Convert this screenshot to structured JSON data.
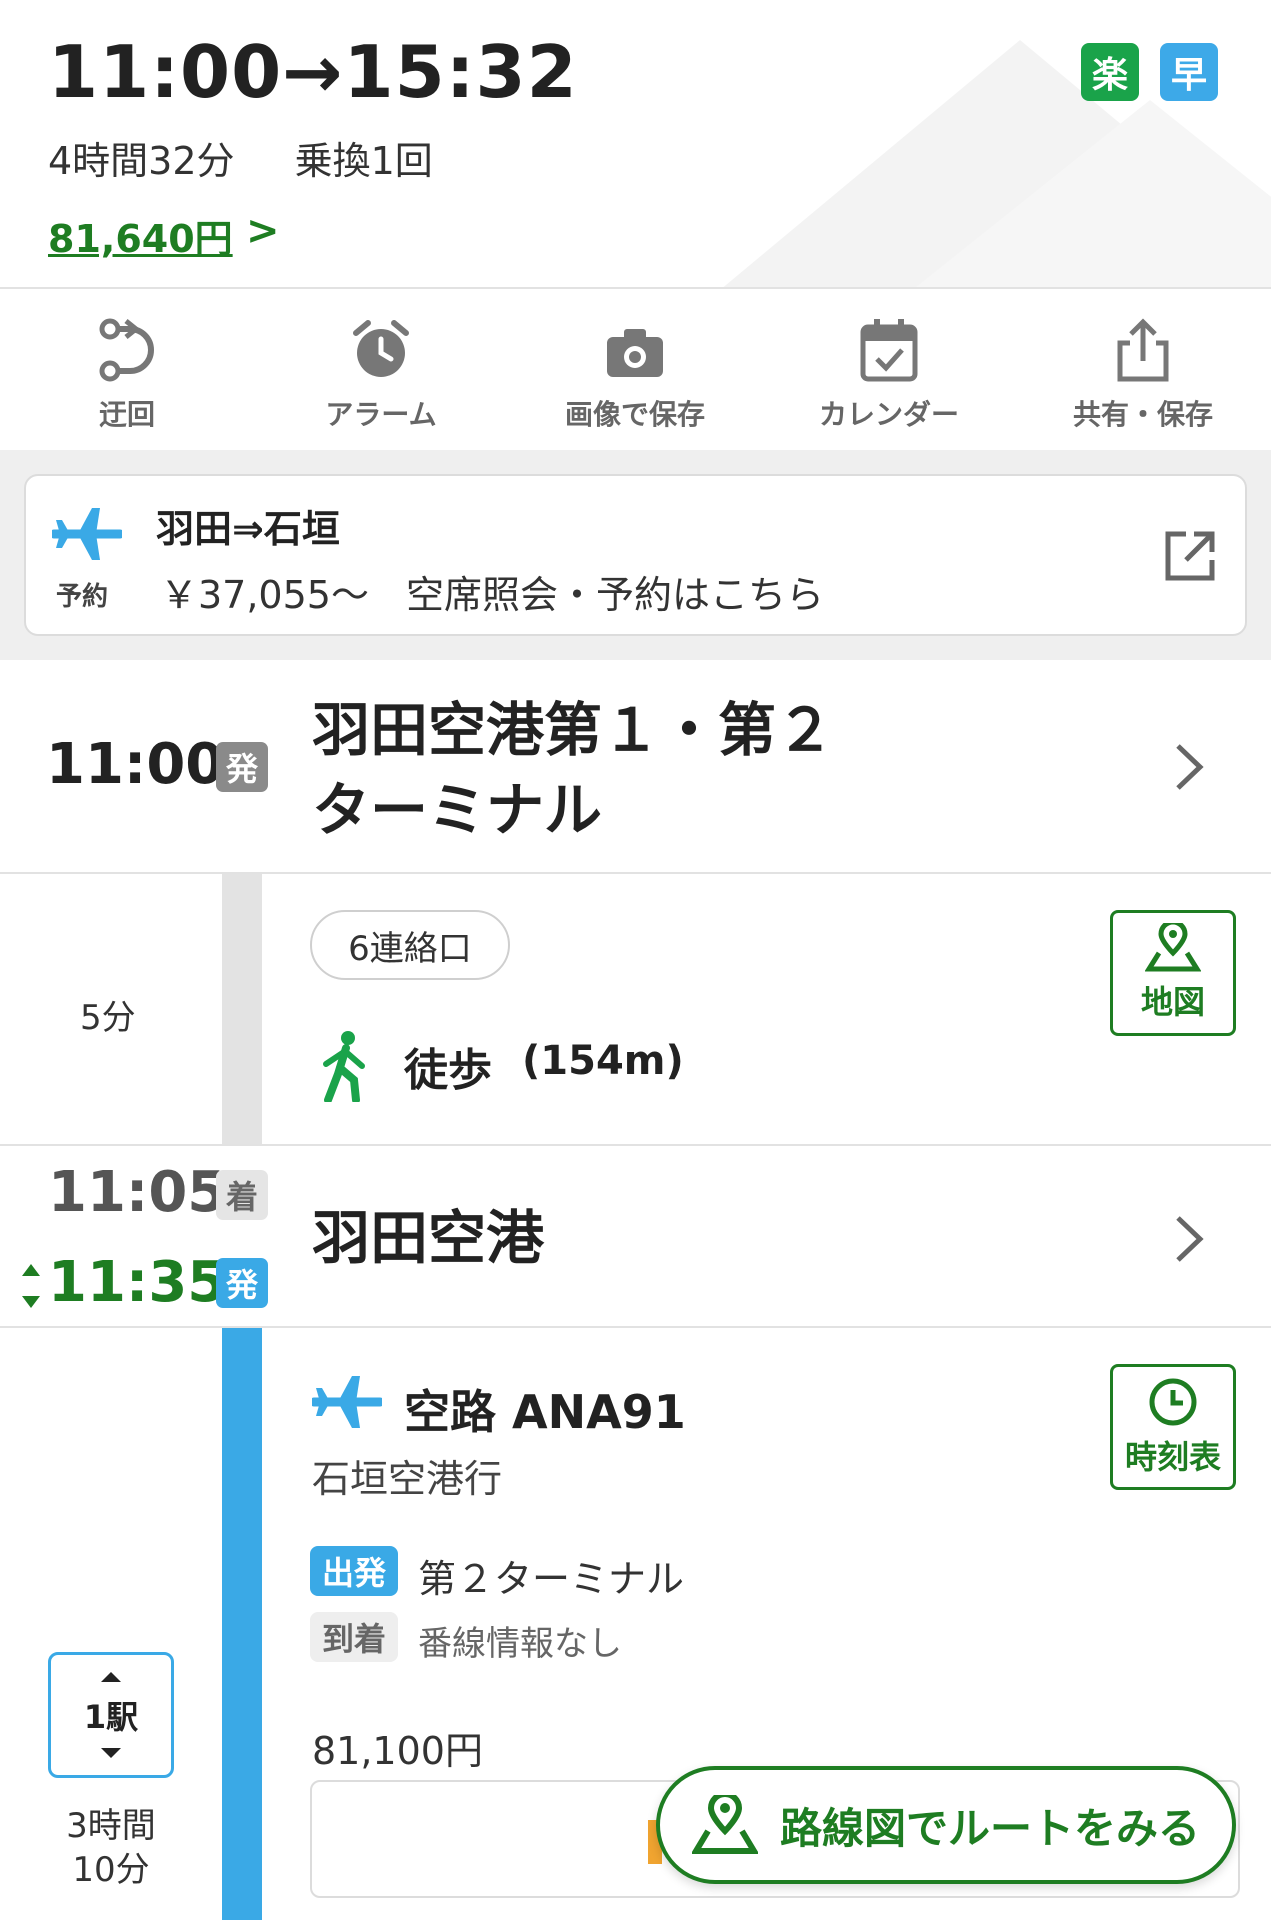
{
  "header": {
    "time_range": "11:00→15:32",
    "duration": "4時間32分",
    "transfers": "乗換1回",
    "fare": "81,640円",
    "fare_chevron": ">",
    "badge_easy": "楽",
    "badge_fast": "早"
  },
  "toolbar": {
    "items": [
      {
        "label": "迂回",
        "icon": "detour-icon"
      },
      {
        "label": "アラーム",
        "icon": "alarm-clock-icon"
      },
      {
        "label": "画像で保存",
        "icon": "camera-icon"
      },
      {
        "label": "カレンダー",
        "icon": "calendar-check-icon"
      },
      {
        "label": "共有・保存",
        "icon": "share-icon"
      }
    ]
  },
  "banner": {
    "route": "羽田⇒石垣",
    "price": "￥37,055〜",
    "info": "空席照会・予約はこちら",
    "reserve_label": "予約"
  },
  "departure_station": {
    "time": "11:00",
    "tag": "発",
    "name_line1": "羽田空港第１・第２",
    "name_line2": "ターミナル"
  },
  "walk_segment": {
    "duration": "5分",
    "exit": "6連絡口",
    "mode": "徒歩",
    "distance": "(154m)",
    "map_label": "地図"
  },
  "transfer_station": {
    "arrive_time": "11:05",
    "arrive_tag": "着",
    "depart_time": "11:35",
    "depart_tag": "発",
    "name": "羽田空港"
  },
  "flight_segment": {
    "title": "空路 ANA91",
    "destination": "石垣空港行",
    "depart_tag": "出発",
    "depart_info": "第２ターミナル",
    "arrive_tag": "到着",
    "arrive_info": "番線情報なし",
    "fare": "81,100円",
    "timetable_label": "時刻表",
    "stops": "1駅",
    "duration_line1": "3時間",
    "duration_line2": "10分"
  },
  "route_map_button": {
    "label": "路線図でルートをみる"
  },
  "colors": {
    "green": "#1e7d22",
    "blue": "#3aa9e6",
    "badge_green": "#1aa34a",
    "gray_tag": "#8a8a8a"
  }
}
